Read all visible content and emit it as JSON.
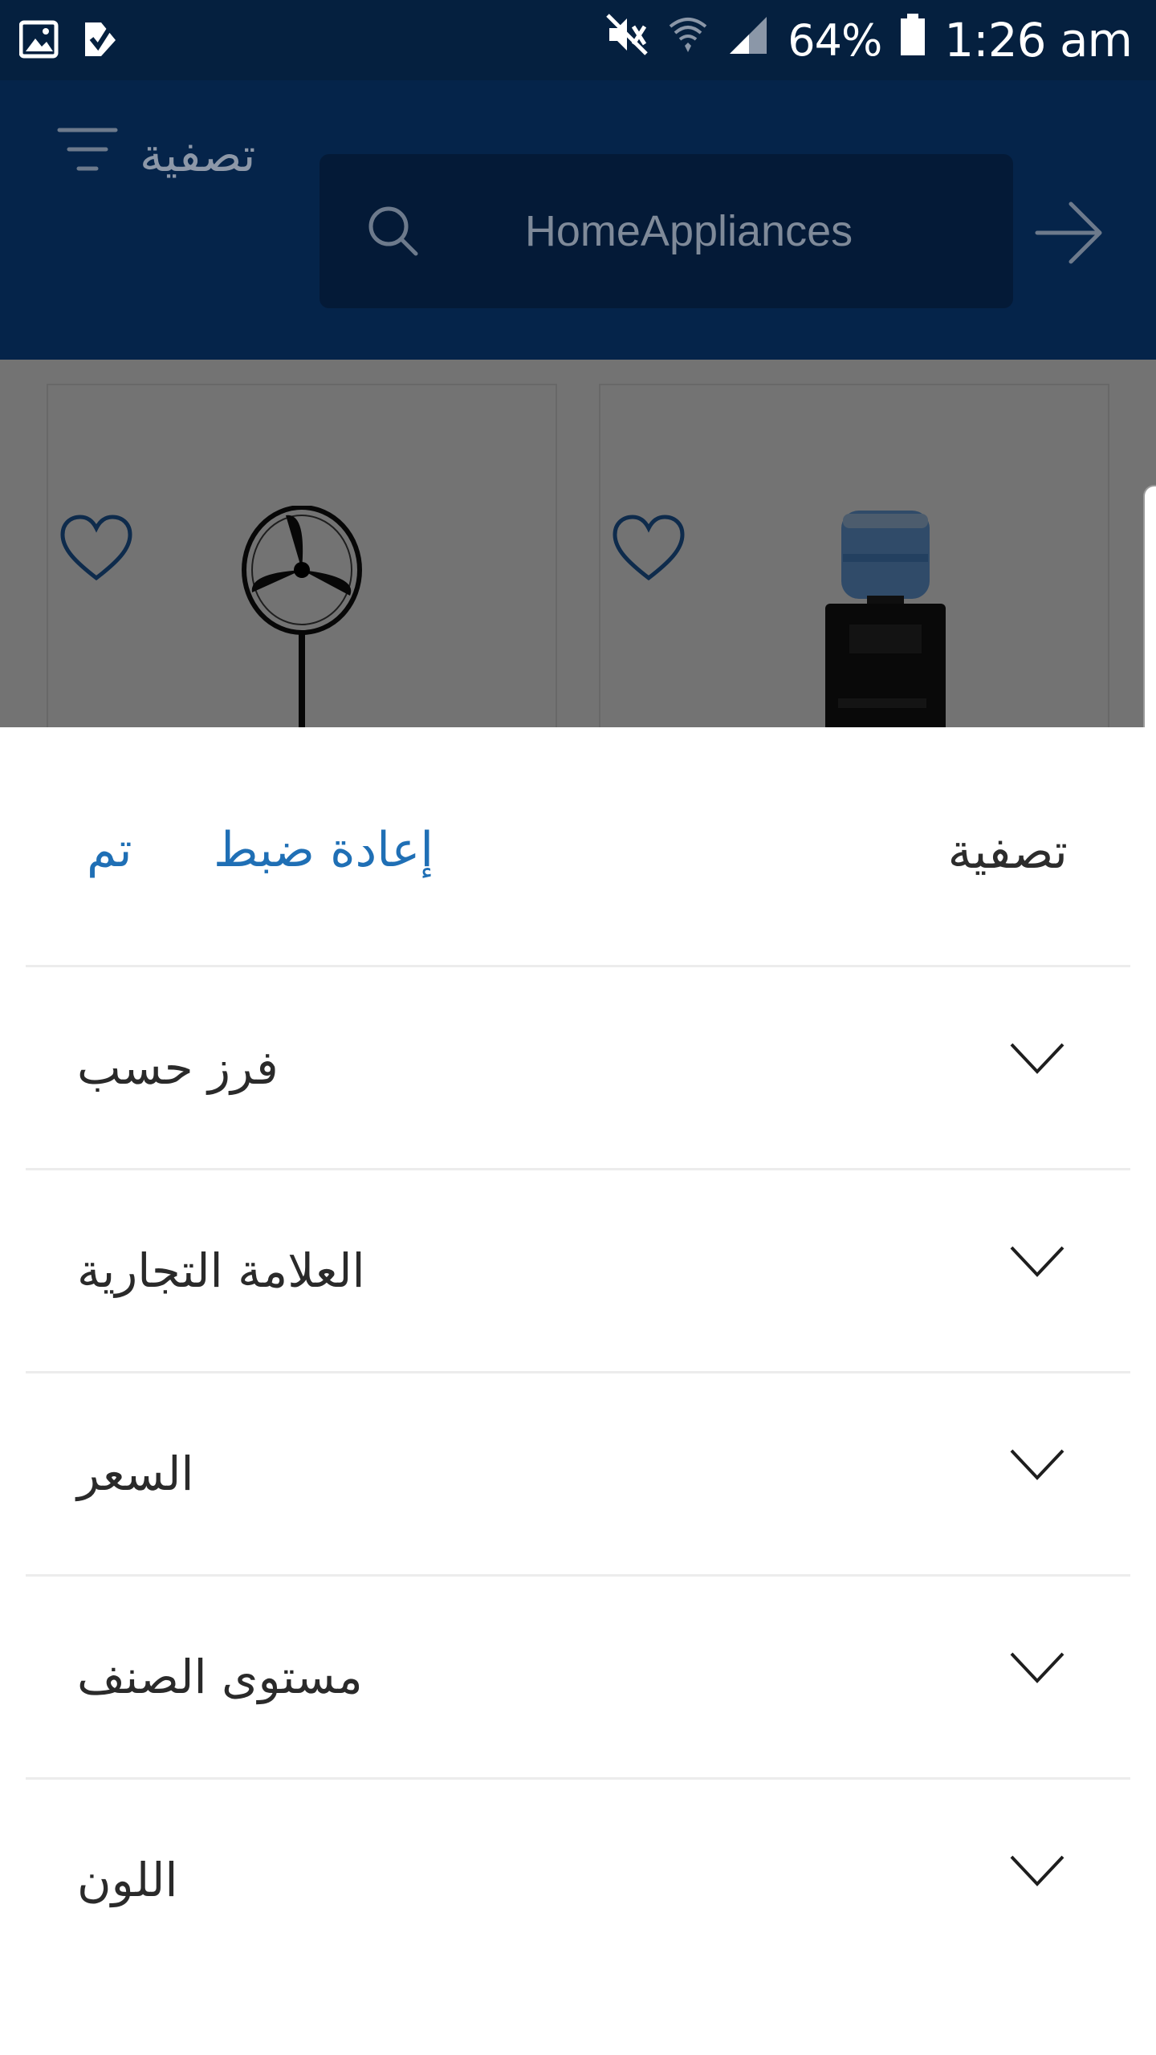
{
  "status_bar": {
    "battery_percent": "64%",
    "time": "1:26 am",
    "icons": [
      "gallery-icon",
      "task-check-icon",
      "mute-icon",
      "wifi-icon",
      "signal-icon",
      "battery-icon"
    ]
  },
  "header": {
    "filter_label": "تصفية",
    "search_text": "HomeAppliances"
  },
  "products": [
    {
      "image": "standing-fan",
      "favorite_icon": "heart-icon"
    },
    {
      "image": "water-dispenser",
      "favorite_icon": "heart-icon"
    }
  ],
  "sheet": {
    "title": "تصفية",
    "reset_label": "إعادة ضبط",
    "done_label": "تم",
    "rows": [
      {
        "label": "فرز حسب"
      },
      {
        "label": "العلامة التجارية"
      },
      {
        "label": "السعر"
      },
      {
        "label": "مستوى الصنف"
      },
      {
        "label": "اللون"
      }
    ]
  },
  "colors": {
    "status_bar": "#05203f",
    "header": "#05244a",
    "search_box": "#041a37",
    "accent_link": "#1f6fb5",
    "text": "#2a2a2a"
  }
}
